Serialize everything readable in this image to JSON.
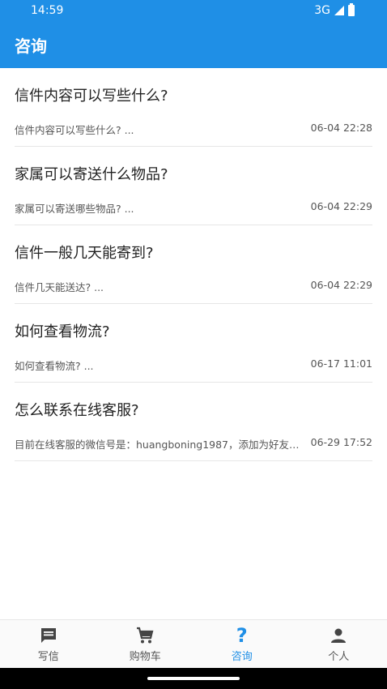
{
  "status": {
    "time": "14:59",
    "network": "3G"
  },
  "header": {
    "title": "咨询"
  },
  "items": [
    {
      "title": "信件内容可以写些什么?",
      "summary": "信件内容可以写些什么? ...",
      "time": "06-04 22:28"
    },
    {
      "title": "家属可以寄送什么物品?",
      "summary": "家属可以寄送哪些物品? ...",
      "time": "06-04 22:29"
    },
    {
      "title": "信件一般几天能寄到?",
      "summary": "信件几天能送达? ...",
      "time": "06-04 22:29"
    },
    {
      "title": "如何查看物流?",
      "summary": "如何查看物流? ...",
      "time": "06-17 11:01"
    },
    {
      "title": "怎么联系在线客服?",
      "summary": "目前在线客服的微信号是：huangboning1987，添加为好友后...",
      "time": "06-29 17:52"
    }
  ],
  "nav": {
    "write_label": "写信",
    "cart_label": "购物车",
    "consult_label": "咨询",
    "profile_label": "个人"
  },
  "colors": {
    "accent": "#1f8fe6"
  }
}
